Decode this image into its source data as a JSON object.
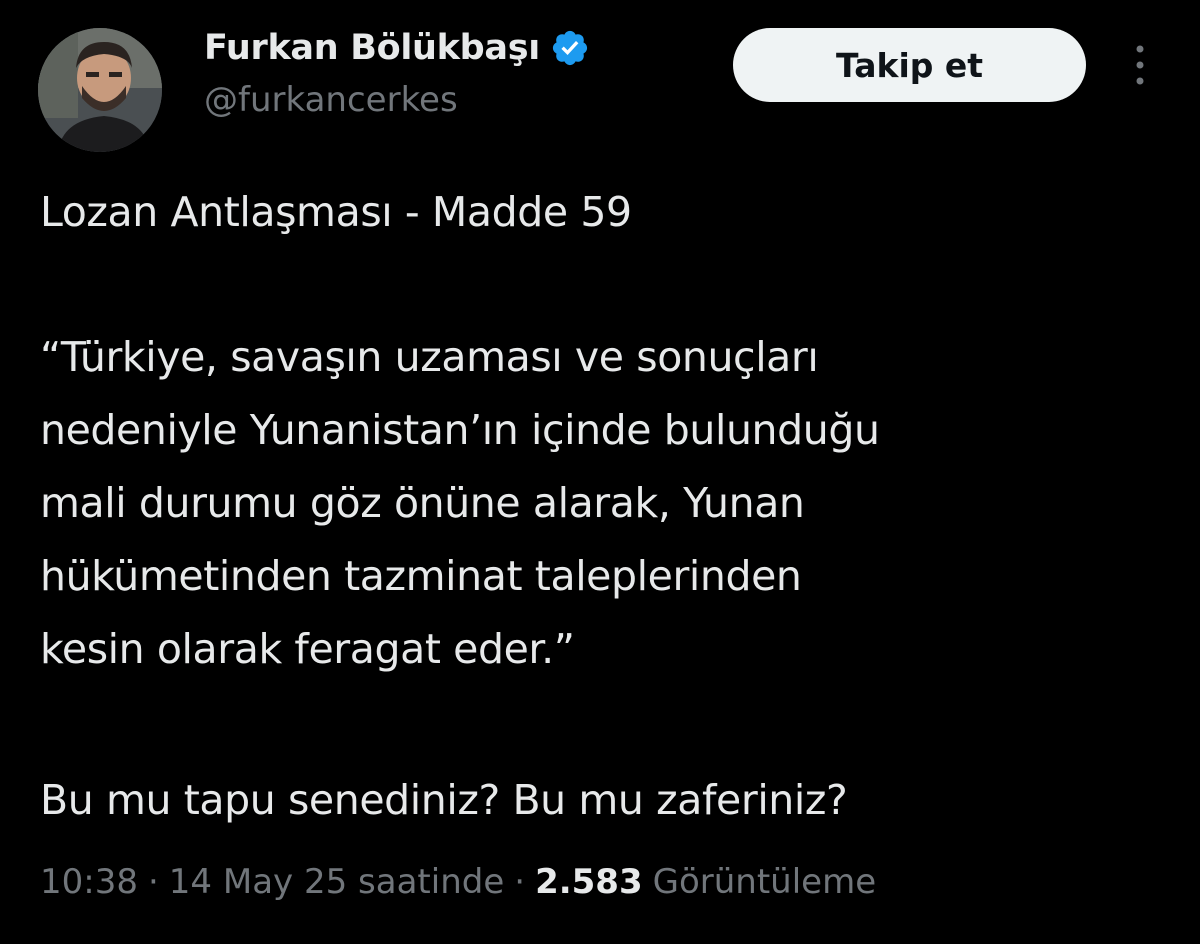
{
  "author": {
    "display_name": "Furkan Bölükbaşı",
    "handle": "@furkancerkes",
    "verified": true
  },
  "actions": {
    "follow_label": "Takip et"
  },
  "tweet": {
    "title_line": "Lozan Antlaşması - Madde 59",
    "quote_lines": [
      "“Türkiye, savaşın uzaması ve sonuçları",
      "nedeniyle Yunanistan’ın içinde bulunduğu",
      "mali durumu göz önüne alarak, Yunan",
      "hükümetinden tazminat taleplerinden",
      "kesin olarak feragat eder.”"
    ],
    "closing_line": "Bu mu tapu senediniz? Bu mu zaferiniz?"
  },
  "meta": {
    "time": "10:38",
    "separator": "·",
    "date_text": "14 May 25 saatinde",
    "views_count": "2.583",
    "views_label": "Görüntüleme"
  },
  "colors": {
    "background": "#000000",
    "text_primary": "#e7e9ea",
    "text_secondary": "#71767b",
    "verified_blue": "#1d9bf0",
    "button_bg": "#eff3f4"
  },
  "icons": {
    "verified": "verified-badge-icon",
    "more": "more-vertical-icon"
  }
}
